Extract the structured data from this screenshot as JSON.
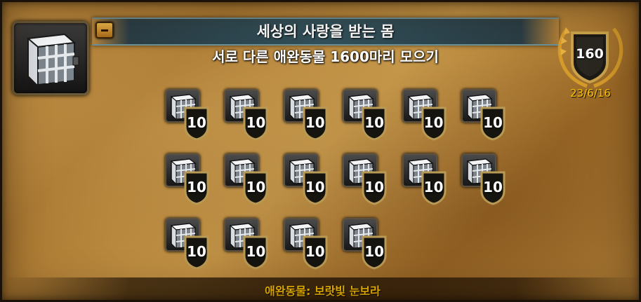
{
  "achievement": {
    "title": "세상의 사랑을 받는 몸",
    "description": "서로 다른 애완동물 1600마리 모으기",
    "points": "160",
    "date": "23/6/16",
    "reward": "애완동물: 보랏빛 눈보라",
    "icon": "cage-icon"
  },
  "criteria": [
    {
      "points": "10",
      "icon": "cage-icon"
    },
    {
      "points": "10",
      "icon": "cage-icon"
    },
    {
      "points": "10",
      "icon": "cage-icon"
    },
    {
      "points": "10",
      "icon": "cage-icon"
    },
    {
      "points": "10",
      "icon": "cage-icon"
    },
    {
      "points": "10",
      "icon": "cage-icon"
    },
    {
      "points": "10",
      "icon": "cage-icon"
    },
    {
      "points": "10",
      "icon": "cage-icon"
    },
    {
      "points": "10",
      "icon": "cage-icon"
    },
    {
      "points": "10",
      "icon": "cage-icon"
    },
    {
      "points": "10",
      "icon": "cage-icon"
    },
    {
      "points": "10",
      "icon": "cage-icon"
    },
    {
      "points": "10",
      "icon": "cage-icon"
    },
    {
      "points": "10",
      "icon": "cage-icon"
    },
    {
      "points": "10",
      "icon": "cage-icon"
    },
    {
      "points": "10",
      "icon": "cage-icon"
    }
  ],
  "colors": {
    "title_band": "#31505a",
    "date_text": "#ffc600",
    "reward_text": "#ffc600",
    "parchment": "#b8863b"
  }
}
